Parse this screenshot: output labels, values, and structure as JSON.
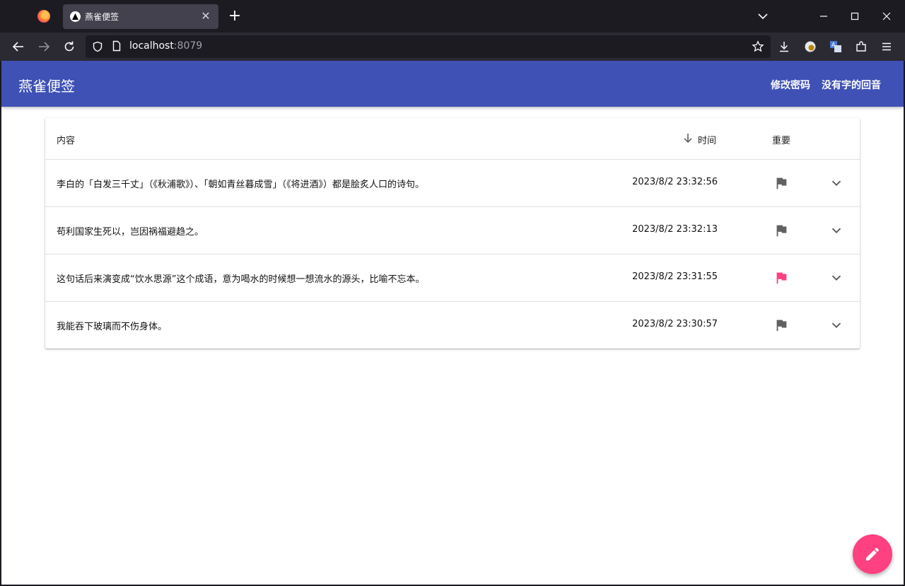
{
  "browser": {
    "tab_title": "燕雀便签",
    "url_host": "localhost",
    "url_port": ":8079"
  },
  "app": {
    "title": "燕雀便签",
    "actions": [
      "修改密码",
      "没有字的回音"
    ]
  },
  "table": {
    "columns": {
      "content": "内容",
      "time": "时间",
      "important": "重要"
    },
    "rows": [
      {
        "content": "李白的「白发三千丈」（《秋浦歌》）、「朝如青丝暮成雪」（《将进酒》）都是脍炙人口的诗句。",
        "time": "2023/8/2 23:32:56",
        "important": false
      },
      {
        "content": "苟利国家生死以，岂因祸福避趋之。",
        "time": "2023/8/2 23:32:13",
        "important": false
      },
      {
        "content": "这句话后来演变成“饮水思源”这个成语，意为喝水的时候想一想流水的源头，比喻不忘本。",
        "time": "2023/8/2 23:31:55",
        "important": true
      },
      {
        "content": "我能吞下玻璃而不伤身体。",
        "time": "2023/8/2 23:30:57",
        "important": false
      }
    ]
  },
  "colors": {
    "appbar": "#3f51b5",
    "accent": "#ff4081",
    "flag_off": "#616161",
    "flag_on": "#ff4081"
  },
  "icons": {
    "sort": "arrow-down-icon",
    "flag": "flag-icon",
    "expand": "chevron-down-icon",
    "fab": "pencil-icon"
  }
}
